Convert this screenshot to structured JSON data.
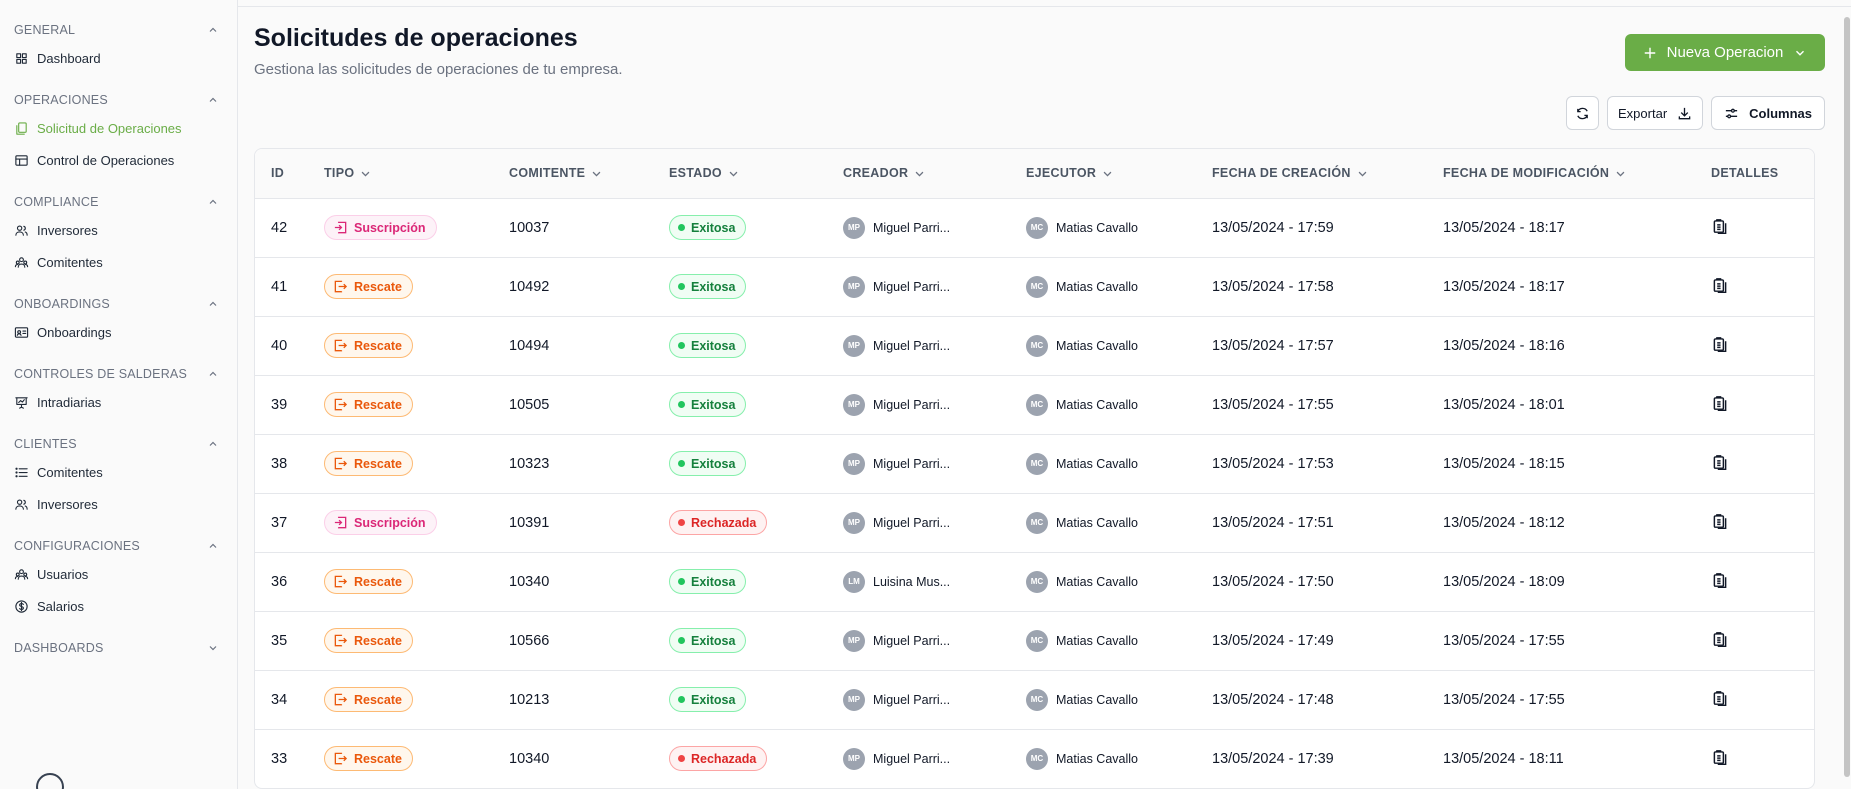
{
  "sidebar": {
    "sections": [
      {
        "label": "GENERAL",
        "items": [
          {
            "label": "Dashboard",
            "icon": "grid-icon"
          }
        ]
      },
      {
        "label": "OPERACIONES",
        "items": [
          {
            "label": "Solicitud de Operaciones",
            "icon": "copy-icon",
            "active": true
          },
          {
            "label": "Control de Operaciones",
            "icon": "table-icon"
          }
        ]
      },
      {
        "label": "COMPLIANCE",
        "items": [
          {
            "label": "Inversores",
            "icon": "users-icon"
          },
          {
            "label": "Comitentes",
            "icon": "users-group-icon"
          }
        ]
      },
      {
        "label": "ONBOARDINGS",
        "items": [
          {
            "label": "Onboardings",
            "icon": "id-card-icon"
          }
        ]
      },
      {
        "label": "CONTROLES DE SALDERAS",
        "items": [
          {
            "label": "Intradiarias",
            "icon": "presentation-icon"
          }
        ]
      },
      {
        "label": "CLIENTES",
        "items": [
          {
            "label": "Comitentes",
            "icon": "list-icon"
          },
          {
            "label": "Inversores",
            "icon": "users-icon"
          }
        ]
      },
      {
        "label": "CONFIGURACIONES",
        "items": [
          {
            "label": "Usuarios",
            "icon": "users-group-icon"
          },
          {
            "label": "Salarios",
            "icon": "dollar-icon"
          }
        ]
      },
      {
        "label": "DASHBOARDS",
        "items": []
      }
    ]
  },
  "header": {
    "title": "Solicitudes de operaciones",
    "subtitle": "Gestiona las solicitudes de operaciones de tu empresa.",
    "new_button": "Nueva Operacion",
    "export_button": "Exportar",
    "columns_button": "Columnas"
  },
  "table": {
    "columns": [
      "ID",
      "TIPO",
      "COMITENTE",
      "ESTADO",
      "CREADOR",
      "EJECUTOR",
      "FECHA DE CREACIÓN",
      "FECHA DE MODIFICACIÓN",
      "DETALLES"
    ],
    "rows": [
      {
        "id": "42",
        "tipo": "Suscripción",
        "comitente": "10037",
        "estado": "Exitosa",
        "creador_initials": "MP",
        "creador": "Miguel Parri...",
        "ejecutor_initials": "MC",
        "ejecutor": "Matias Cavallo",
        "fc": "13/05/2024 - 17:59",
        "fm": "13/05/2024 - 18:17"
      },
      {
        "id": "41",
        "tipo": "Rescate",
        "comitente": "10492",
        "estado": "Exitosa",
        "creador_initials": "MP",
        "creador": "Miguel Parri...",
        "ejecutor_initials": "MC",
        "ejecutor": "Matias Cavallo",
        "fc": "13/05/2024 - 17:58",
        "fm": "13/05/2024 - 18:17"
      },
      {
        "id": "40",
        "tipo": "Rescate",
        "comitente": "10494",
        "estado": "Exitosa",
        "creador_initials": "MP",
        "creador": "Miguel Parri...",
        "ejecutor_initials": "MC",
        "ejecutor": "Matias Cavallo",
        "fc": "13/05/2024 - 17:57",
        "fm": "13/05/2024 - 18:16"
      },
      {
        "id": "39",
        "tipo": "Rescate",
        "comitente": "10505",
        "estado": "Exitosa",
        "creador_initials": "MP",
        "creador": "Miguel Parri...",
        "ejecutor_initials": "MC",
        "ejecutor": "Matias Cavallo",
        "fc": "13/05/2024 - 17:55",
        "fm": "13/05/2024 - 18:01"
      },
      {
        "id": "38",
        "tipo": "Rescate",
        "comitente": "10323",
        "estado": "Exitosa",
        "creador_initials": "MP",
        "creador": "Miguel Parri...",
        "ejecutor_initials": "MC",
        "ejecutor": "Matias Cavallo",
        "fc": "13/05/2024 - 17:53",
        "fm": "13/05/2024 - 18:15"
      },
      {
        "id": "37",
        "tipo": "Suscripción",
        "comitente": "10391",
        "estado": "Rechazada",
        "creador_initials": "MP",
        "creador": "Miguel Parri...",
        "ejecutor_initials": "MC",
        "ejecutor": "Matias Cavallo",
        "fc": "13/05/2024 - 17:51",
        "fm": "13/05/2024 - 18:12"
      },
      {
        "id": "36",
        "tipo": "Rescate",
        "comitente": "10340",
        "estado": "Exitosa",
        "creador_initials": "LM",
        "creador": "Luisina Mus...",
        "ejecutor_initials": "MC",
        "ejecutor": "Matias Cavallo",
        "fc": "13/05/2024 - 17:50",
        "fm": "13/05/2024 - 18:09"
      },
      {
        "id": "35",
        "tipo": "Rescate",
        "comitente": "10566",
        "estado": "Exitosa",
        "creador_initials": "MP",
        "creador": "Miguel Parri...",
        "ejecutor_initials": "MC",
        "ejecutor": "Matias Cavallo",
        "fc": "13/05/2024 - 17:49",
        "fm": "13/05/2024 - 17:55"
      },
      {
        "id": "34",
        "tipo": "Rescate",
        "comitente": "10213",
        "estado": "Exitosa",
        "creador_initials": "MP",
        "creador": "Miguel Parri...",
        "ejecutor_initials": "MC",
        "ejecutor": "Matias Cavallo",
        "fc": "13/05/2024 - 17:48",
        "fm": "13/05/2024 - 17:55"
      },
      {
        "id": "33",
        "tipo": "Rescate",
        "comitente": "10340",
        "estado": "Rechazada",
        "creador_initials": "MP",
        "creador": "Miguel Parri...",
        "ejecutor_initials": "MC",
        "ejecutor": "Matias Cavallo",
        "fc": "13/05/2024 - 17:39",
        "fm": "13/05/2024 - 18:11"
      }
    ]
  },
  "colors": {
    "accent": "#6aad47",
    "success": "#22c55e",
    "danger": "#ef4444",
    "suscripcion": "#db2777",
    "rescate": "#ea580c"
  }
}
